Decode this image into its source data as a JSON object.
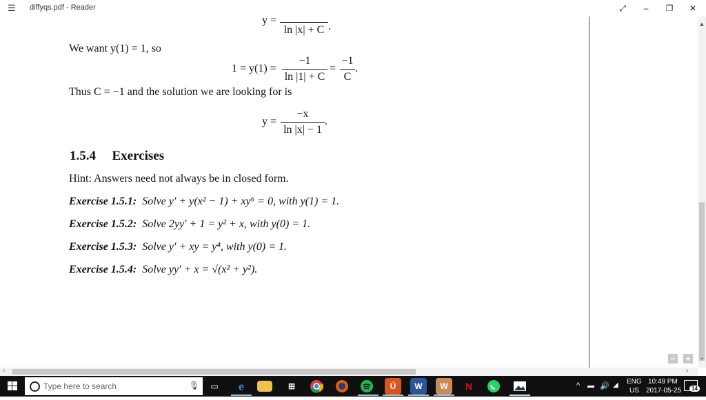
{
  "window": {
    "title": "diffyqs.pdf - Reader"
  },
  "document": {
    "eq_prev": {
      "lhs": "y =",
      "num": "",
      "den": "ln |x| + C",
      "tail": "."
    },
    "want_text": "We want y(1) = 1, so",
    "eq_c": {
      "lhs": "1 = y(1) =",
      "num1": "−1",
      "den1": "ln |1| + C",
      "mid": "=",
      "num2": "−1",
      "den2": "C",
      "tail": "."
    },
    "thus_text": "Thus C = −1 and the solution we are looking for is",
    "eq_sol": {
      "lhs": "y =",
      "num": "−x",
      "den": "ln |x| − 1",
      "tail": "."
    },
    "section_number": "1.5.4",
    "section_title": "Exercises",
    "hint": "Hint: Answers need not always be in closed form.",
    "exercises": [
      {
        "label": "Exercise 1.5.1:",
        "text": "Solve y′ + y(x² − 1) + xy⁶ = 0, with y(1) = 1."
      },
      {
        "label": "Exercise 1.5.2:",
        "text": "Solve 2yy′ + 1 = y² + x, with y(0) = 1."
      },
      {
        "label": "Exercise 1.5.3:",
        "text": "Solve y′ + xy = y⁴, with y(0) = 1."
      },
      {
        "label": "Exercise 1.5.4:",
        "text": "Solve yy′ + x = √(x² + y²)."
      }
    ]
  },
  "zoom": {
    "minus": "−",
    "plus": "+"
  },
  "taskbar": {
    "search_placeholder": "Type here to search",
    "apps": [
      "task-view",
      "edge",
      "file-explorer",
      "store",
      "chrome",
      "firefox",
      "spotify",
      "app-orange",
      "word",
      "app-w",
      "netflix",
      "whatsapp",
      "photos"
    ],
    "lang": "ENG",
    "region": "US",
    "time": "10:49 PM",
    "date": "2017-05-25",
    "notifications": "14"
  },
  "colors": {
    "taskbar": "#101010",
    "accent": "#0078d7"
  }
}
